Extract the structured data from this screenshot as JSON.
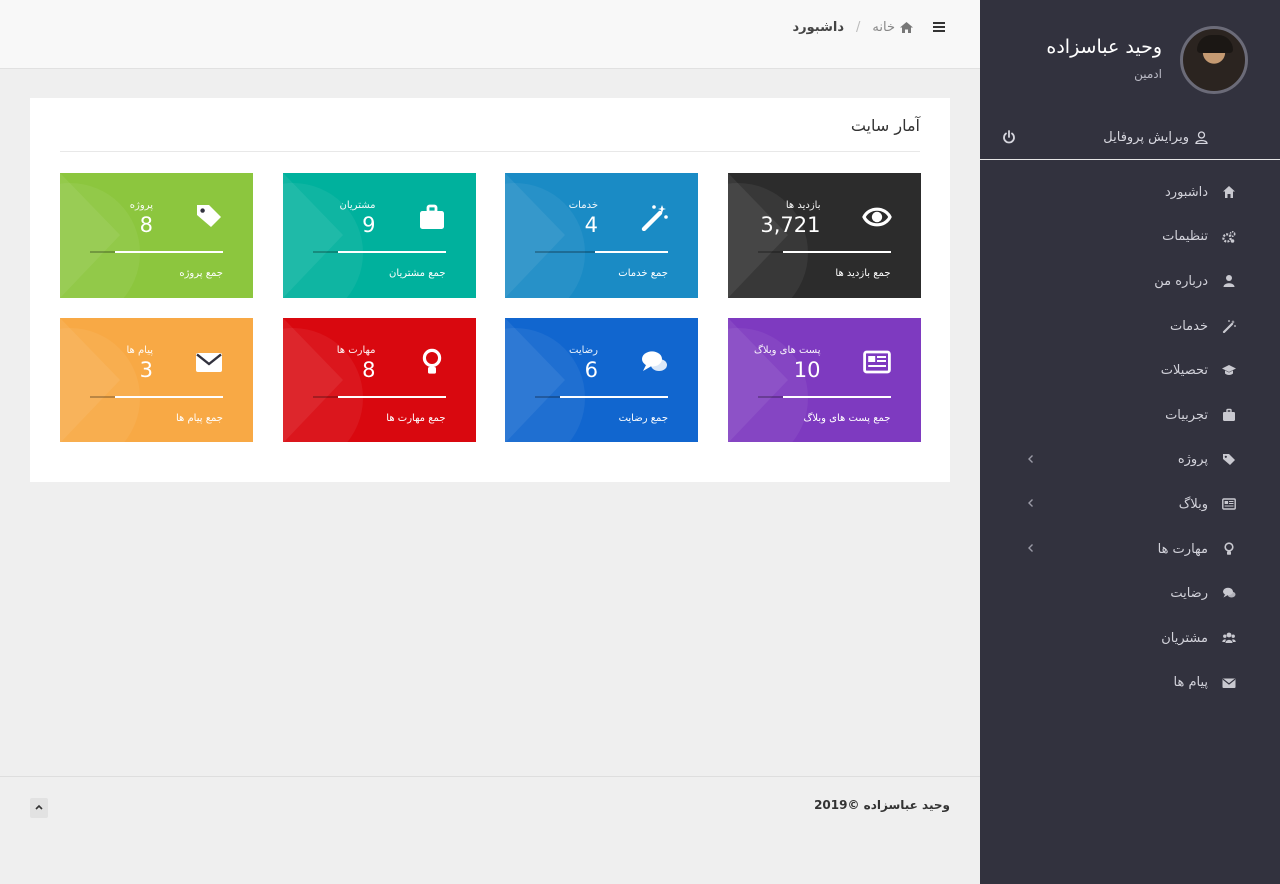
{
  "profile": {
    "name": "وحید عباسزاده",
    "role": "ادمین",
    "edit_label": "ویرایش پروفایل"
  },
  "header": {
    "home_label": "خانه",
    "current_label": "داشبورد"
  },
  "nav": [
    {
      "label": "داشبورد",
      "icon": "home-icon"
    },
    {
      "label": "تنظیمات",
      "icon": "cogs-icon"
    },
    {
      "label": "درباره من",
      "icon": "user-icon"
    },
    {
      "label": "خدمات",
      "icon": "magic-icon"
    },
    {
      "label": "تحصیلات",
      "icon": "graduation-cap-icon"
    },
    {
      "label": "تجربیات",
      "icon": "briefcase-icon"
    },
    {
      "label": "پروژه",
      "icon": "tags-icon",
      "submenu": true
    },
    {
      "label": "وبلاگ",
      "icon": "newspaper-icon",
      "submenu": true
    },
    {
      "label": "مهارت ها",
      "icon": "lightbulb-icon",
      "submenu": true
    },
    {
      "label": "رضایت",
      "icon": "comments-icon"
    },
    {
      "label": "مشتریان",
      "icon": "users-icon"
    },
    {
      "label": "پیام ها",
      "icon": "envelope-icon"
    }
  ],
  "panel": {
    "title": "آمار سایت"
  },
  "stats": [
    {
      "label": "بازدید ها",
      "value": "3,721",
      "total_label": "جمع بازدید ها",
      "color": "#2c2c2c",
      "icon": "eye-icon",
      "progress": 0.81
    },
    {
      "label": "خدمات",
      "value": "4",
      "total_label": "جمع خدمات",
      "color": "#1a8bc5",
      "icon": "magic-icon",
      "progress": 0.55
    },
    {
      "label": "مشتریان",
      "value": "9",
      "total_label": "جمع مشتریان",
      "color": "#00b19d",
      "icon": "briefcase-icon",
      "progress": 0.81
    },
    {
      "label": "پروژه",
      "value": "8",
      "total_label": "جمع پروژه",
      "color": "#8cc63e",
      "icon": "tags-icon",
      "progress": 0.81
    },
    {
      "label": "پست های وبلاگ",
      "value": "10",
      "total_label": "جمع پست های وبلاگ",
      "color": "#7e3ac0",
      "icon": "newspaper-icon",
      "progress": 0.81
    },
    {
      "label": "رضایت",
      "value": "6",
      "total_label": "جمع رضایت",
      "color": "#1166cf",
      "icon": "comments-icon",
      "progress": 0.81
    },
    {
      "label": "مهارت ها",
      "value": "8",
      "total_label": "جمع مهارت ها",
      "color": "#d9080f",
      "icon": "lightbulb-icon",
      "progress": 0.81
    },
    {
      "label": "پیام ها",
      "value": "3",
      "total_label": "جمع پیام ها",
      "color": "#f8a945",
      "icon": "envelope-icon",
      "progress": 0.81
    }
  ],
  "footer": {
    "copyright": "2019© وحید عباسزاده"
  }
}
